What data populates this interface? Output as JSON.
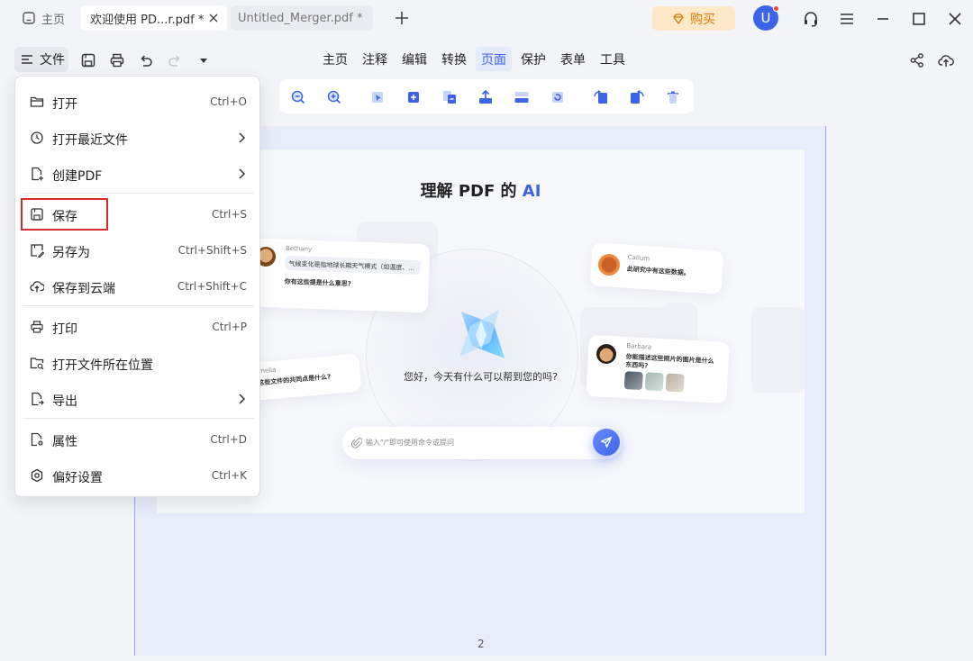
{
  "tabs": {
    "home_label": "主页",
    "doc1_title": "欢迎使用 PD...r.pdf *",
    "doc2_title": "Untitled_Merger.pdf *"
  },
  "header": {
    "buy_label": "购买",
    "avatar_letter": "U",
    "accent": "#3d64e6",
    "buy_color": "#e07b00"
  },
  "toolbar": {
    "file_label": "文件",
    "nav": [
      "主页",
      "注释",
      "编辑",
      "转换",
      "页面",
      "保护",
      "表单",
      "工具"
    ],
    "active_nav": "页面"
  },
  "page_tools": [
    "zoom-out-icon",
    "zoom-in-icon",
    "select-page-icon",
    "insert-page-icon",
    "replace-page-icon",
    "extract-page-icon",
    "split-page-icon",
    "rotate-page-icon",
    "rotate-left-icon",
    "rotate-right-icon",
    "delete-page-icon"
  ],
  "file_menu": {
    "items": [
      {
        "label": "打开",
        "shortcut": "Ctrl+O"
      },
      {
        "label": "打开最近文件",
        "shortcut": ""
      },
      {
        "label": "创建PDF",
        "shortcut": ""
      },
      {
        "label": "保存",
        "shortcut": "Ctrl+S"
      },
      {
        "label": "另存为",
        "shortcut": "Ctrl+Shift+S"
      },
      {
        "label": "保存到云端",
        "shortcut": "Ctrl+Shift+C"
      },
      {
        "label": "打印",
        "shortcut": "Ctrl+P"
      },
      {
        "label": "打开文件所在位置",
        "shortcut": ""
      },
      {
        "label": "导出",
        "shortcut": ""
      },
      {
        "label": "属性",
        "shortcut": "Ctrl+D"
      },
      {
        "label": "偏好设置",
        "shortcut": "Ctrl+K"
      }
    ]
  },
  "document": {
    "title_prefix": "理解 PDF 的 ",
    "title_highlight": "AI",
    "greeting": "您好，今天有什么可以帮到您的吗?",
    "input_placeholder": "输入\"/\"即可使用命令或提问",
    "page_number": "2",
    "cards": {
      "bethany_name": "Bethany",
      "bethany_msg1": "气候变化是指地球长期天气模式（如温度、...",
      "bethany_msg2": "你有这些提是什么意思?",
      "callum_name": "Callum",
      "callum_msg": "此研究中有这些数据。",
      "barbara_name": "Barbara",
      "barbara_msg1": "你能描述这些照片的图片是什么",
      "barbara_msg2": "东西吗?",
      "amelia_name": "melia",
      "amelia_msg": "这些文件的共同点是什么?"
    }
  }
}
